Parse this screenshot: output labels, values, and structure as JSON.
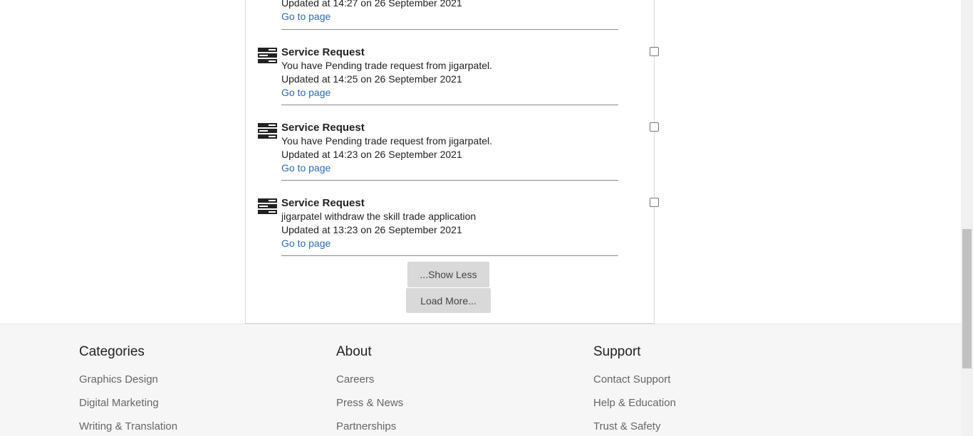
{
  "notifications": [
    {
      "title": "",
      "message": "",
      "updated": "Updated at 14:27 on 26 September 2021",
      "link": "Go to page"
    },
    {
      "title": "Service Request",
      "message": "You have Pending trade request from jigarpatel.",
      "updated": "Updated at 14:25 on 26 September 2021",
      "link": "Go to page"
    },
    {
      "title": "Service Request",
      "message": "You have Pending trade request from jigarpatel.",
      "updated": "Updated at 14:23 on 26 September 2021",
      "link": "Go to page"
    },
    {
      "title": "Service Request",
      "message": "jigarpatel withdraw the skill trade application",
      "updated": "Updated at 13:23 on 26 September 2021",
      "link": "Go to page"
    }
  ],
  "buttons": {
    "show_less": "...Show Less",
    "load_more": "Load More..."
  },
  "footer": {
    "categories": {
      "heading": "Categories",
      "links": [
        "Graphics Design",
        "Digital Marketing",
        "Writing & Translation"
      ]
    },
    "about": {
      "heading": "About",
      "links": [
        "Careers",
        "Press & News",
        "Partnerships"
      ]
    },
    "support": {
      "heading": "Support",
      "links": [
        "Contact Support",
        "Help & Education",
        "Trust & Safety"
      ]
    }
  },
  "icons": {
    "notification_icon": "server-stack-icon"
  },
  "colors": {
    "link": "#2a6ab2",
    "button_bg": "#d9d9d9",
    "footer_bg": "#f6f6f6"
  }
}
